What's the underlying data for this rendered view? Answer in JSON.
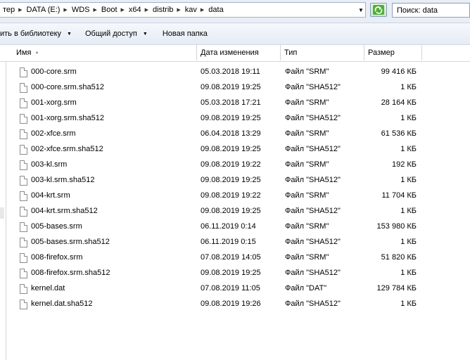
{
  "address_bar": {
    "breadcrumbs": [
      "тер",
      "DATA (E:)",
      "WDS",
      "Boot",
      "x64",
      "distrib",
      "kav",
      "data"
    ],
    "search_placeholder": "Поиск: data"
  },
  "toolbar": {
    "library_label": "ить в библиотеку",
    "share_label": "Общий доступ",
    "new_folder_label": "Новая папка"
  },
  "columns": {
    "name": "Имя",
    "date": "Дата изменения",
    "type": "Тип",
    "size": "Размер"
  },
  "files": [
    {
      "name": "000-core.srm",
      "date": "05.03.2018 19:11",
      "type": "Файл \"SRM\"",
      "size": "99 416 КБ"
    },
    {
      "name": "000-core.srm.sha512",
      "date": "09.08.2019 19:25",
      "type": "Файл \"SHA512\"",
      "size": "1 КБ"
    },
    {
      "name": "001-xorg.srm",
      "date": "05.03.2018 17:21",
      "type": "Файл \"SRM\"",
      "size": "28 164 КБ"
    },
    {
      "name": "001-xorg.srm.sha512",
      "date": "09.08.2019 19:25",
      "type": "Файл \"SHA512\"",
      "size": "1 КБ"
    },
    {
      "name": "002-xfce.srm",
      "date": "06.04.2018 13:29",
      "type": "Файл \"SRM\"",
      "size": "61 536 КБ"
    },
    {
      "name": "002-xfce.srm.sha512",
      "date": "09.08.2019 19:25",
      "type": "Файл \"SHA512\"",
      "size": "1 КБ"
    },
    {
      "name": "003-kl.srm",
      "date": "09.08.2019 19:22",
      "type": "Файл \"SRM\"",
      "size": "192 КБ"
    },
    {
      "name": "003-kl.srm.sha512",
      "date": "09.08.2019 19:25",
      "type": "Файл \"SHA512\"",
      "size": "1 КБ"
    },
    {
      "name": "004-krt.srm",
      "date": "09.08.2019 19:22",
      "type": "Файл \"SRM\"",
      "size": "11 704 КБ"
    },
    {
      "name": "004-krt.srm.sha512",
      "date": "09.08.2019 19:25",
      "type": "Файл \"SHA512\"",
      "size": "1 КБ"
    },
    {
      "name": "005-bases.srm",
      "date": "06.11.2019 0:14",
      "type": "Файл \"SRM\"",
      "size": "153 980 КБ"
    },
    {
      "name": "005-bases.srm.sha512",
      "date": "06.11.2019 0:15",
      "type": "Файл \"SHA512\"",
      "size": "1 КБ"
    },
    {
      "name": "008-firefox.srm",
      "date": "07.08.2019 14:05",
      "type": "Файл \"SRM\"",
      "size": "51 820 КБ"
    },
    {
      "name": "008-firefox.srm.sha512",
      "date": "09.08.2019 19:25",
      "type": "Файл \"SHA512\"",
      "size": "1 КБ"
    },
    {
      "name": "kernel.dat",
      "date": "07.08.2019 11:05",
      "type": "Файл \"DAT\"",
      "size": "129 784 КБ"
    },
    {
      "name": "kernel.dat.sha512",
      "date": "09.08.2019 19:26",
      "type": "Файл \"SHA512\"",
      "size": "1 КБ"
    }
  ],
  "colors": {
    "address_bg": "#e9eef6",
    "toolbar_bg": "#e6ecf5",
    "border": "#d5d5d5",
    "refresh_green": "#3a9a2a"
  }
}
